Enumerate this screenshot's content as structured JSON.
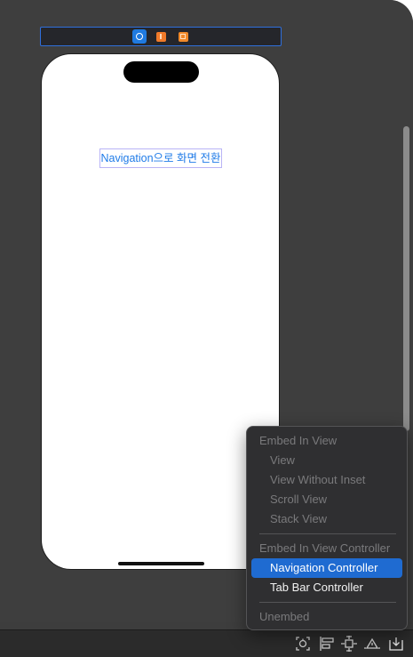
{
  "scene": {
    "button_title": "Navigation으로 화면 전환",
    "dock_icons": [
      "view-controller-icon",
      "first-responder-icon",
      "exit-icon"
    ]
  },
  "colors": {
    "canvas": "#3e3e3e",
    "accent": "#1f6bd1",
    "button_text": "#1f7be8",
    "button_border": "#b9b4f6"
  },
  "menu": {
    "embed_in_view_header": "Embed In View",
    "view": "View",
    "view_without_inset": "View Without Inset",
    "scroll_view": "Scroll View",
    "stack_view": "Stack View",
    "embed_in_view_controller_header": "Embed In View Controller",
    "navigation_controller": "Navigation Controller",
    "tab_bar_controller": "Tab Bar Controller",
    "unembed": "Unembed"
  },
  "toolbar": {
    "icons": [
      "update-frames-icon",
      "align-icon",
      "add-constraints-icon",
      "resolve-issues-icon",
      "embed-in-icon"
    ]
  }
}
